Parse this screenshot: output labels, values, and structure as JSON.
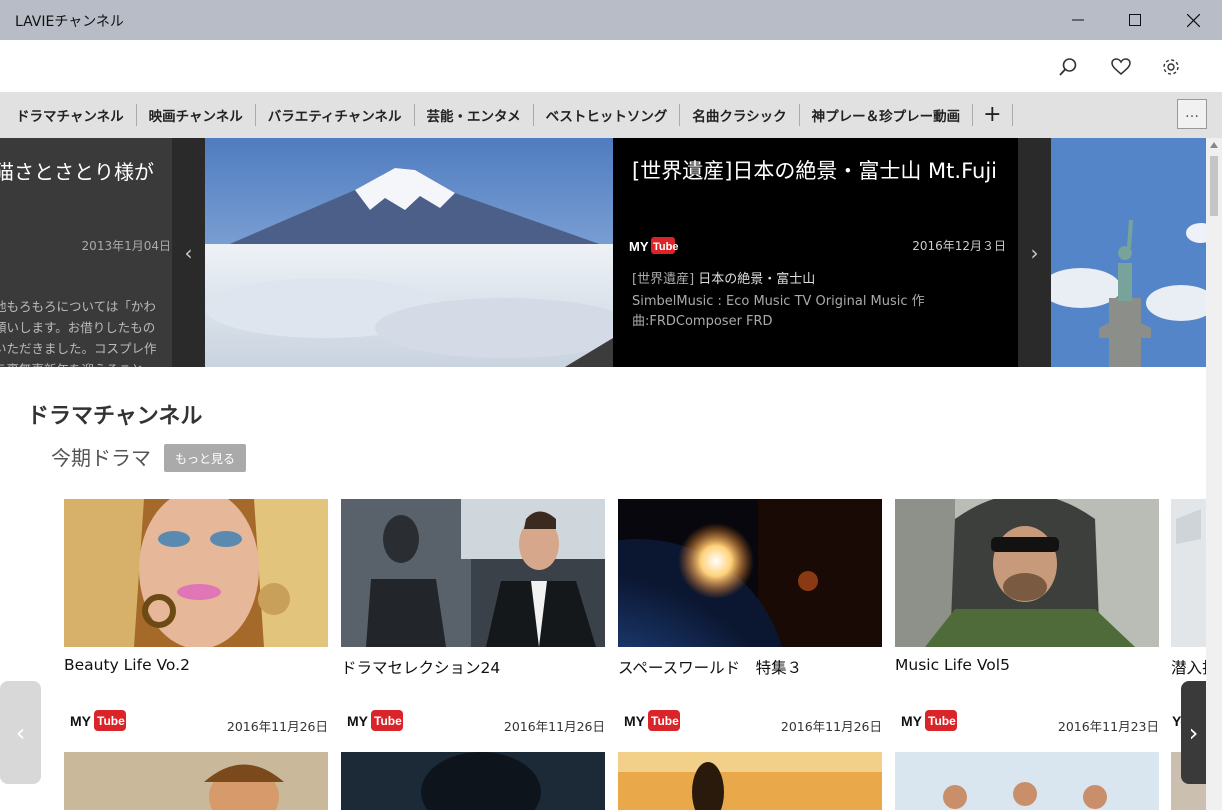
{
  "window": {
    "title": "LAVIEチャンネル"
  },
  "toolbar": {
    "search_icon": "search-icon",
    "favorite_icon": "heart-icon",
    "settings_icon": "gear-icon"
  },
  "tabs": [
    "ドラマチャンネル",
    "映画チャンネル",
    "バラエティチャンネル",
    "芸能・エンタメ",
    "ベストヒットソング",
    "名曲クラシック",
    "神プレー＆珍プレー動画"
  ],
  "tab_add": "+",
  "tab_more": "…",
  "hero": {
    "prev": {
      "title": "猫さとさとり様が",
      "date": "2013年1月04日",
      "desc": [
        "他もろもろについては「かわ",
        "頼いします。お借りしたもの",
        "いただきました。コスプレ作",
        "ラ裏無事新年を迎えること-"
      ]
    },
    "feature": {
      "title": "[世界遺産]日本の絶景・富士山 Mt.Fuji",
      "date": "2016年12月３日",
      "subtitle_tag": "[世界遺産]",
      "subtitle_name": "日本の絶景・富士山",
      "desc": "SimbelMusic : Eco Music TV Original Music 作曲:FRDComposer FRD"
    },
    "prev_arrow": "‹",
    "next_arrow": "›"
  },
  "section": {
    "title": "ドラマチャンネル",
    "subtitle": "今期ドラマ",
    "more_label": "もっと見る"
  },
  "cards": [
    {
      "title": "Beauty Life Vo.2",
      "date": "2016年11月26日"
    },
    {
      "title": "ドラマセレクション24",
      "date": "2016年11月26日"
    },
    {
      "title": "スペースワールド　特集３",
      "date": "2016年11月26日"
    },
    {
      "title": "Music Life Vol5",
      "date": "2016年11月23日"
    },
    {
      "title": "潜入打",
      "date": ""
    }
  ],
  "logo": {
    "my": "MY",
    "tube": "Tube",
    "you": "You"
  },
  "pager": {
    "prev": "‹",
    "next": "›"
  }
}
